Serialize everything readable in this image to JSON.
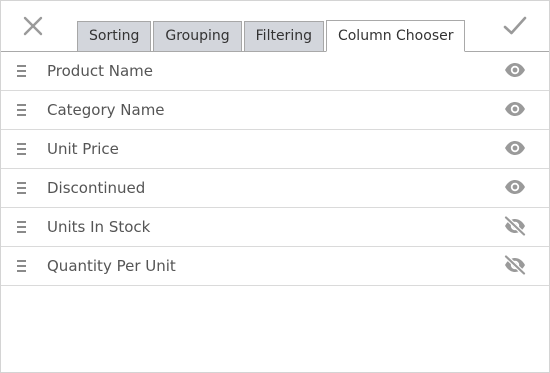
{
  "toolbar": {
    "close_icon": "close-icon",
    "apply_icon": "checkmark-icon"
  },
  "tabs": [
    {
      "label": "Sorting",
      "active": false
    },
    {
      "label": "Grouping",
      "active": false
    },
    {
      "label": "Filtering",
      "active": false
    },
    {
      "label": "Column Chooser",
      "active": true
    }
  ],
  "columns": [
    {
      "name": "Product Name",
      "visible": true
    },
    {
      "name": "Category Name",
      "visible": true
    },
    {
      "name": "Unit Price",
      "visible": true
    },
    {
      "name": "Discontinued",
      "visible": true
    },
    {
      "name": "Units In Stock",
      "visible": false
    },
    {
      "name": "Quantity Per Unit",
      "visible": false
    }
  ],
  "colors": {
    "icon": "#9a9a9a",
    "tab_inactive_bg": "#d3d6dc",
    "text": "#555555"
  }
}
